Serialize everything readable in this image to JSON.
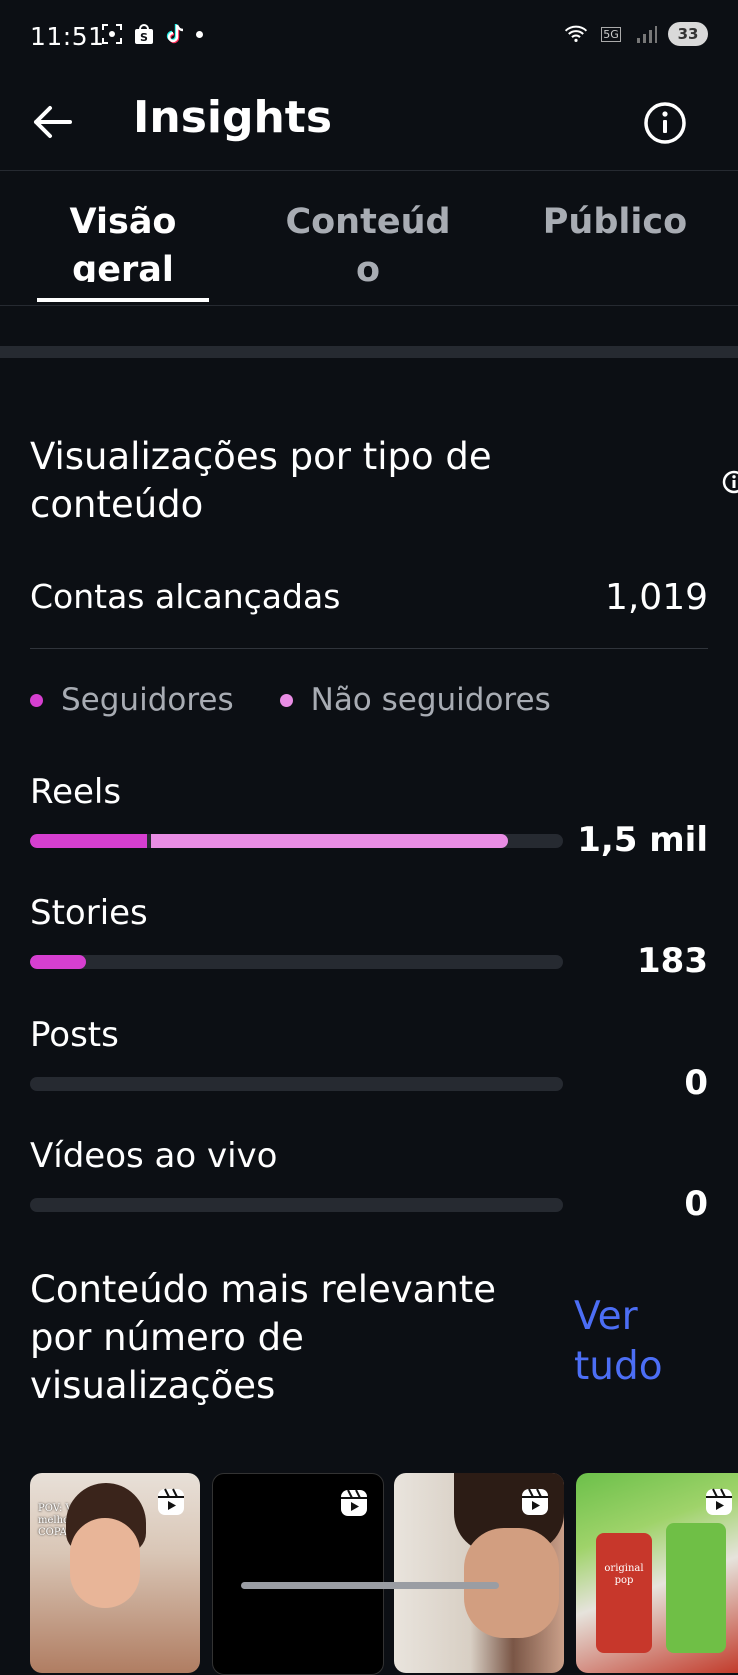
{
  "status_bar": {
    "time": "11:51",
    "battery": "33",
    "network": "5G"
  },
  "header": {
    "title": "Insights"
  },
  "tabs": [
    {
      "label_line1": "Visão",
      "label_line2": "geral",
      "active": true
    },
    {
      "label_line1": "Conteúd",
      "label_line2": "o",
      "active": false
    },
    {
      "label_line1": "Público",
      "label_line2": "",
      "active": false
    }
  ],
  "views_section": {
    "title": "Visualizações por tipo de conteúdo",
    "reach_label": "Contas alcançadas",
    "reach_value": "1,019",
    "legend": [
      {
        "label": "Seguidores",
        "color": "#d63fd0"
      },
      {
        "label": "Não seguidores",
        "color": "#e98de4"
      }
    ],
    "metrics": [
      {
        "label": "Reels",
        "value": "1,5 mil",
        "followers_fraction": 0.22,
        "non_followers_fraction": 0.67
      },
      {
        "label": "Stories",
        "value": "183",
        "followers_fraction": 0.105,
        "non_followers_fraction": 0.0
      },
      {
        "label": "Posts",
        "value": "0",
        "followers_fraction": 0.0,
        "non_followers_fraction": 0.0
      },
      {
        "label": "Vídeos ao vivo",
        "value": "0",
        "followers_fraction": 0.0,
        "non_followers_fraction": 0.0
      }
    ]
  },
  "relevant_section": {
    "title": "Conteúdo mais relevante por número de visualizações",
    "see_all": "Ver tudo",
    "thumbnails": [
      {
        "caption": "POV: Vc sabe do melhor pra assistir a COPA"
      },
      {
        "caption": ""
      },
      {
        "caption": ""
      },
      {
        "caption": "original pop"
      }
    ]
  },
  "colors": {
    "background": "#0c0f14",
    "followers": "#d63fd0",
    "non_followers": "#e98de4",
    "track": "#262a31",
    "link": "#4c6ef5"
  }
}
